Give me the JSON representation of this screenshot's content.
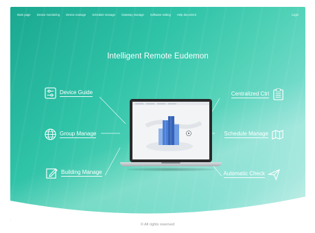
{
  "nav": {
    "items": [
      "Main page",
      "Device monitoring",
      "Device manage",
      "Schedule manage",
      "Gateway manage",
      "Software setting",
      "Help document"
    ],
    "login": "Login"
  },
  "hero": {
    "title": "Intelligent Remote Eudemon"
  },
  "features": {
    "device_guide": "Device Guide",
    "group_manage": "Group Manage",
    "building_manage": "Building Manage",
    "centralized_ctrl": "Centralized Ctrl",
    "schedule_manage": "Schedule Manage",
    "automatic_check": "Automatic Check"
  },
  "footer": {
    "copyright": "© All rights reserved"
  },
  "colors": {
    "accent": "#2fc3a8",
    "accent_dark": "#1aa890"
  }
}
